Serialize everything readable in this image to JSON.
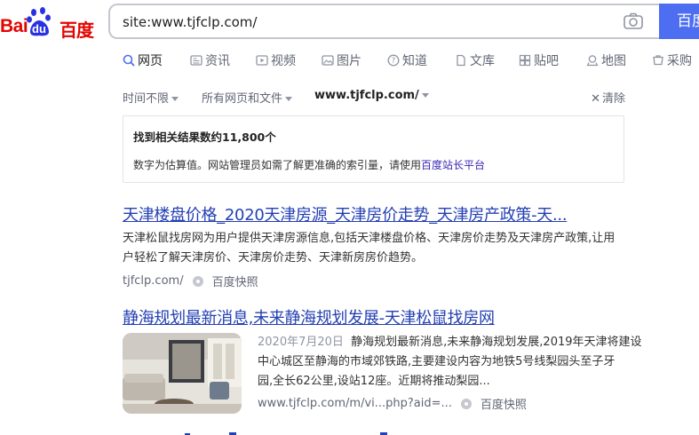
{
  "logo": {
    "bai": "Bai",
    "du": "du",
    "cn": "百度"
  },
  "search": {
    "query": "site:www.tjfclp.com/",
    "button_label": "百度一下"
  },
  "tabs": [
    {
      "label": "网页",
      "icon": "search-icon",
      "active": true
    },
    {
      "label": "资讯",
      "icon": "news-icon"
    },
    {
      "label": "视频",
      "icon": "video-icon"
    },
    {
      "label": "图片",
      "icon": "image-icon"
    },
    {
      "label": "知道",
      "icon": "question-icon"
    },
    {
      "label": "文库",
      "icon": "document-icon"
    },
    {
      "label": "贴吧",
      "icon": "tieba-icon"
    },
    {
      "label": "地图",
      "icon": "map-icon"
    },
    {
      "label": "采购",
      "icon": "cart-icon"
    }
  ],
  "filters": {
    "time": "时间不限",
    "type": "所有网页和文件",
    "site": "www.tjfclp.com/",
    "clear": "清除"
  },
  "info": {
    "count_text": "找到相关结果数约11,800个",
    "note_text": "数字为估算值。网站管理员如需了解更准确的索引量，请使用",
    "note_link": "百度站长平台"
  },
  "results": [
    {
      "title": "天津楼盘价格_2020天津房源_天津房价走势_天津房产政策-天...",
      "abstract_line1": "天津松鼠找房网为用户提供天津房源信息,包括天津楼盘价格、天津房价走势及天津房产政策,让用",
      "abstract_line2": "户轻松了解天津房价、天津房价走势、天津新房房价趋势。",
      "url": "tjfclp.com/",
      "snapshot": "百度快照"
    },
    {
      "title": "静海规划最新消息,未来静海规划发展-天津松鼠找房网",
      "date": "2020年7月20日",
      "abstract_line1": "静海规划最新消息,未来静海规划发展,2019年天津将建设",
      "abstract_line2": "中心城区至静海的市域郊铁路,主要建设内容为地铁5号线梨园头至子牙",
      "abstract_line3": "园,全长62公里,设站12座。近期将推动梨园...",
      "url": "www.tjfclp.com/m/vi...php?aid=...",
      "snapshot": "百度快照"
    }
  ],
  "colors": {
    "accent": "#4e6ef2",
    "link": "#2440b3",
    "brand_red": "#e10602"
  }
}
